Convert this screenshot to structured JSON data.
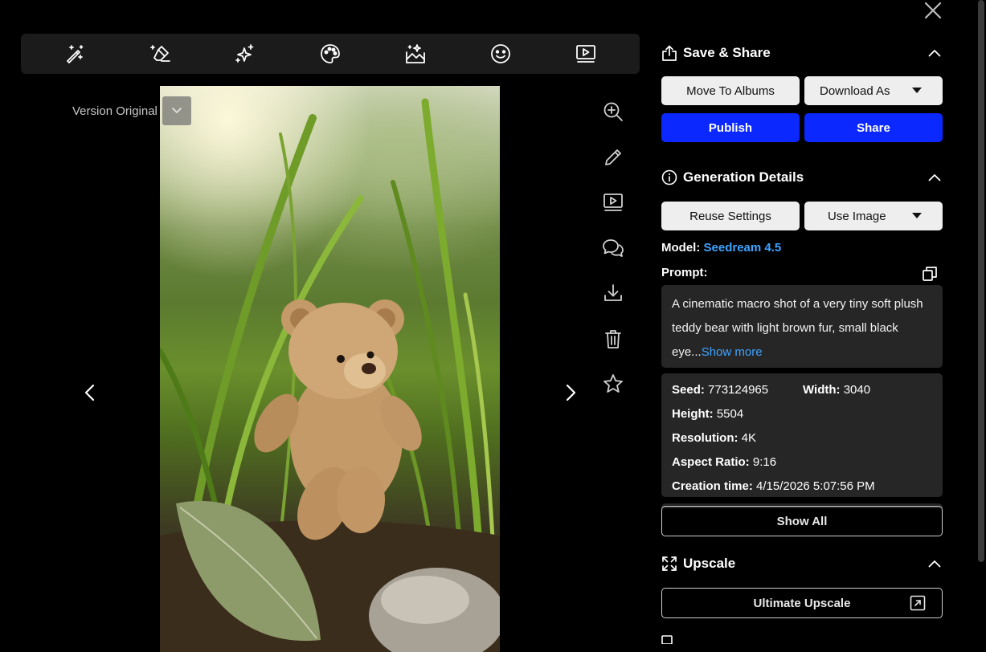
{
  "toolbar": {
    "tools": [
      "magic-wand-icon",
      "eraser-icon",
      "sparkles-icon",
      "palette-icon",
      "image-magic-icon",
      "smiley-icon",
      "video-icon"
    ]
  },
  "viewer": {
    "version_label": "Version Original",
    "image_description_icon": "photo"
  },
  "side_actions": [
    "zoom-in-icon",
    "edit-pencil-icon",
    "video-icon",
    "comments-icon",
    "download-icon",
    "trash-icon",
    "star-icon"
  ],
  "save_share": {
    "title": "Save & Share",
    "move_to_albums": "Move To Albums",
    "download_as": "Download As",
    "publish": "Publish",
    "share": "Share"
  },
  "generation": {
    "title": "Generation Details",
    "reuse_settings": "Reuse Settings",
    "use_image": "Use Image",
    "model_label": "Model:",
    "model_value": "Seedream 4.5",
    "prompt_label": "Prompt:",
    "prompt_text": "A cinematic macro shot of a very tiny soft plush teddy bear with light brown fur, small black eye...",
    "show_more": "Show more",
    "details": {
      "seed_label": "Seed:",
      "seed": "773124965",
      "width_label": "Width:",
      "width": "3040",
      "height_label": "Height:",
      "height": "5504",
      "resolution_label": "Resolution:",
      "resolution": "4K",
      "aspect_label": "Aspect Ratio:",
      "aspect": "9:16",
      "creation_label": "Creation time:",
      "creation": "4/15/2026 5:07:56 PM"
    },
    "show_all": "Show All"
  },
  "upscale": {
    "title": "Upscale",
    "ultimate": "Ultimate Upscale"
  },
  "colors": {
    "accent_blue": "#0a28ff",
    "link_blue": "#3fa3ff",
    "panel_dark": "#262626"
  }
}
